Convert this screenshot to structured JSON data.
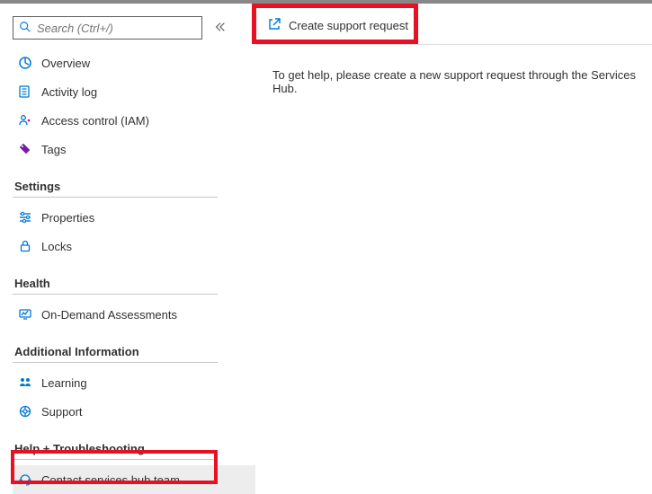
{
  "search": {
    "placeholder": "Search (Ctrl+/)"
  },
  "nav": {
    "top": [
      {
        "label": "Overview"
      },
      {
        "label": "Activity log"
      },
      {
        "label": "Access control (IAM)"
      },
      {
        "label": "Tags"
      }
    ],
    "sections": [
      {
        "header": "Settings",
        "items": [
          {
            "label": "Properties"
          },
          {
            "label": "Locks"
          }
        ]
      },
      {
        "header": "Health",
        "items": [
          {
            "label": "On-Demand Assessments"
          }
        ]
      },
      {
        "header": "Additional Information",
        "items": [
          {
            "label": "Learning"
          },
          {
            "label": "Support"
          }
        ]
      },
      {
        "header": "Help + Troubleshooting",
        "items": [
          {
            "label": "Contact services hub team"
          }
        ]
      }
    ]
  },
  "toolbar": {
    "create_support_request": "Create support request"
  },
  "main": {
    "help_text": "To get help, please create a new support request through the Services Hub."
  }
}
